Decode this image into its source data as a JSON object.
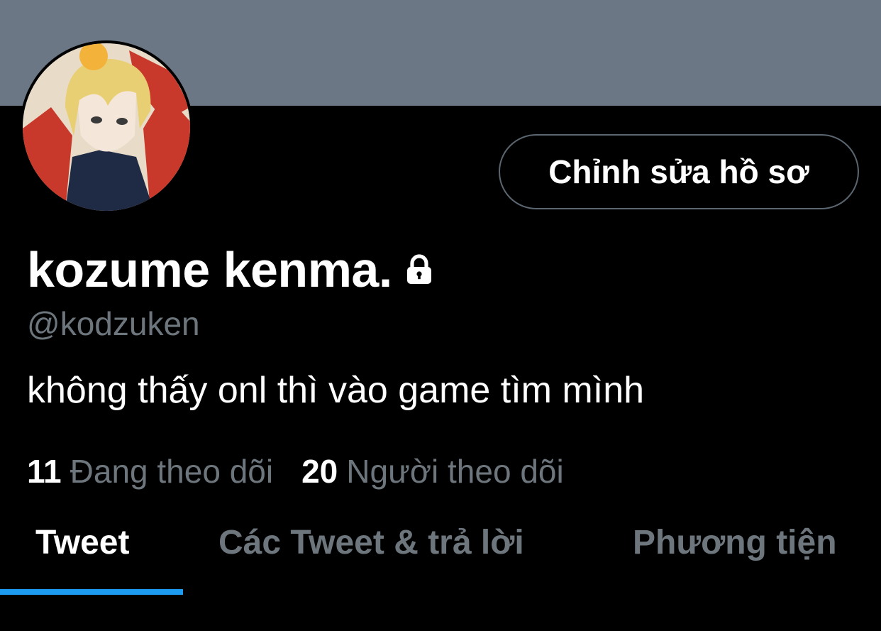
{
  "profile": {
    "display_name": "kozume kenma.",
    "handle": "@kodzuken",
    "bio": "không thấy onl thì vào game tìm mình",
    "edit_profile_label": "Chỉnh sửa hồ sơ",
    "protected_icon": "lock-icon"
  },
  "stats": {
    "following_count": "11",
    "following_label": "Đang theo dõi",
    "followers_count": "20",
    "followers_label": "Người theo dõi"
  },
  "tabs": [
    {
      "label": "Tweet",
      "active": true
    },
    {
      "label": "Các Tweet & trả lời",
      "active": false
    },
    {
      "label": "Phương tiện",
      "active": false
    }
  ],
  "colors": {
    "background": "#000000",
    "banner": "#6b7784",
    "secondary_text": "#6e767d",
    "accent": "#1d9bf0",
    "button_border": "#5b6670"
  }
}
